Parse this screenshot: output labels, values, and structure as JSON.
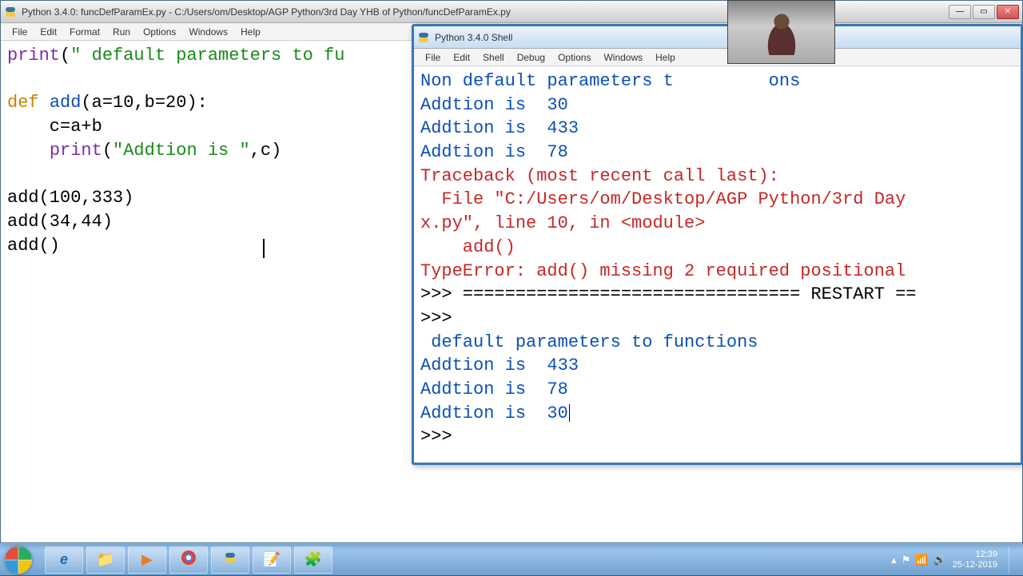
{
  "editor": {
    "title": "Python 3.4.0: funcDefParamEx.py - C:/Users/om/Desktop/AGP Python/3rd Day YHB of Python/funcDefParamEx.py",
    "menu": [
      "File",
      "Edit",
      "Format",
      "Run",
      "Options",
      "Windows",
      "Help"
    ],
    "code": {
      "l1a": "print",
      "l1b": "(",
      "l1c": "\" default parameters to fu",
      "l3a": "def ",
      "l3b": "add",
      "l3c": "(a=",
      "l3d": "10",
      "l3e": ",b=",
      "l3f": "20",
      "l3g": "):",
      "l4": "    c=a+b",
      "l5a": "    ",
      "l5b": "print",
      "l5c": "(",
      "l5d": "\"Addtion is \"",
      "l5e": ",c)",
      "l7": "add(100,333)",
      "l8": "add(34,44)",
      "l9": "add()"
    }
  },
  "shell": {
    "title": "Python 3.4.0 Shell",
    "menu": [
      "File",
      "Edit",
      "Shell",
      "Debug",
      "Options",
      "Windows",
      "Help"
    ],
    "lines": {
      "s1": "Non default parameters t         ons",
      "s2": "Addtion is  30",
      "s3": "Addtion is  433",
      "s4": "Addtion is  78",
      "s5": "Traceback (most recent call last):",
      "s6": "  File \"C:/Users/om/Desktop/AGP Python/3rd Day",
      "s7": "x.py\", line 10, in <module>",
      "s8": "    add()",
      "s9": "TypeError: add() missing 2 required positional",
      "s10": ">>> ================================ RESTART ==",
      "s11": ">>> ",
      "s12": " default parameters to functions",
      "s13": "Addtion is  433",
      "s14": "Addtion is  78",
      "s15": "Addtion is  30",
      "s16": ">>> "
    }
  },
  "taskbar": {
    "time": "12:39",
    "date": "25-12-2019"
  },
  "winbtn": {
    "min": "—",
    "max": "▭",
    "close": "✕"
  }
}
